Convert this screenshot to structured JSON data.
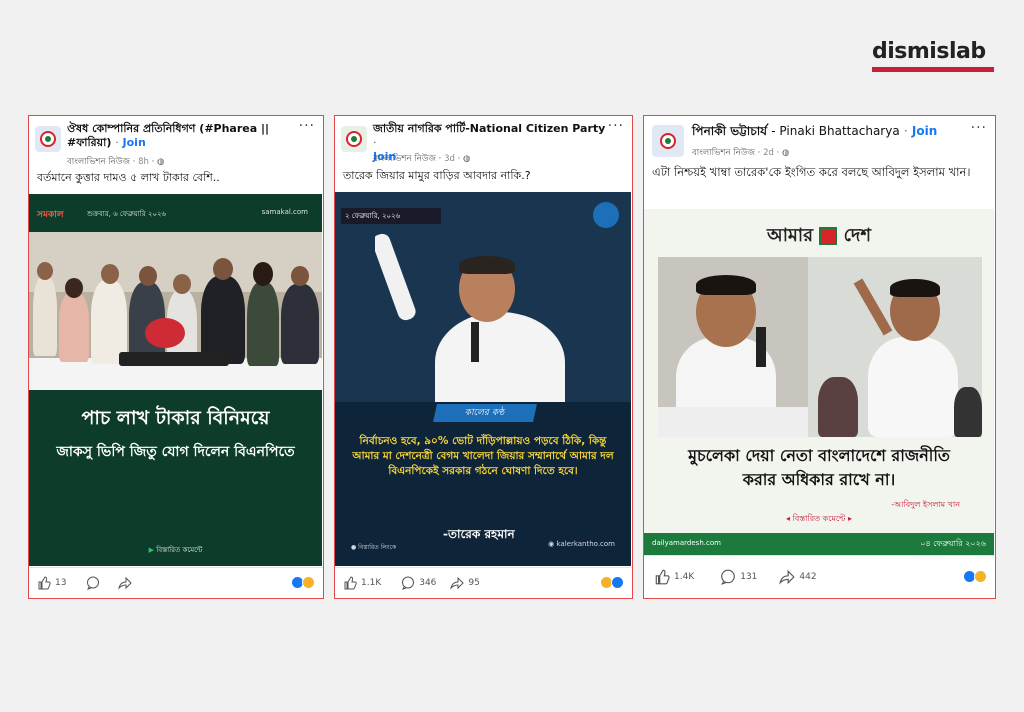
{
  "brand": {
    "logo_text": "dismislab",
    "accent": "#c8203a"
  },
  "posts": [
    {
      "page_name": "ঔষধ কোম্পানির প্রতিনিধিগণ (#Pharea || #ফারিয়া)",
      "join": "Join",
      "source": "বাংলাভিশন নিউজ",
      "time": "8h",
      "caption": "বর্তমানে কুত্তার দামও ৫ লাখ টাকার বেশি..",
      "image": {
        "outlet": "সমকাল",
        "date": "শুক্রবার, ৬ ফেব্রুয়ারি ২০২৬",
        "site": "samakal.com",
        "headline1": "পাচ লাখ টাকার বিনিময়ে",
        "headline2": "জাকসু ভিপি জিতু যোগ দিলেন বিএনপিতে",
        "cta": "বিস্তারিত কমেন্টে"
      },
      "likes": "13",
      "comments": "",
      "shares": ""
    },
    {
      "page_name": "জাতীয় নাগরিক পার্টি-National Citizen Party",
      "join": "Join",
      "source": "বাংলাভিশন নিউজ",
      "time": "3d",
      "caption": "তারেক জিয়ার মামুর বাড়ির আবদার নাকি.?",
      "image": {
        "date": "২ ফেব্রুয়ারি, ২০২৬",
        "outlet": "কালের কণ্ঠ",
        "quote": "নির্বাচনও হবে, ৯০% ভোট দাঁড়িপাল্লায়ও পড়বে ঠিকি, কিন্তু আমার মা দেশনেত্রী বেগম খালেদা জিয়ার সম্মানার্থে আমার দল বিএনপিকেই সরকার গঠনে ঘোষণা দিতে হবে।",
        "speaker": "-তারেক রহমান",
        "cta": "বিস্তারিত লিংকে",
        "site": "kalerkantho.com"
      },
      "likes": "1.1K",
      "comments": "346",
      "shares": "95"
    },
    {
      "page_name": "পিনাকী ভট্টাচার্য",
      "page_name_en": "- Pinaki Bhattacharya",
      "join": "Join",
      "source": "বাংলাভিশন নিউজ",
      "time": "2d",
      "caption": "এটা নিশ্চয়ই খাম্বা তারেক'কে ইংগিত করে বলছে আবিদুল ইসলাম খান।",
      "image": {
        "outlet": "আমার দেশ",
        "outlet_left": "আমার",
        "outlet_right": "দেশ",
        "headline1": "মুচলেকা দেয়া নেতা বাংলাদেশে রাজনীতি",
        "headline2": "করার অধিকার রাখে না।",
        "attribution": "-আবিদুল ইসলাম খান",
        "cta": "বিস্তারিত কমেন্টে",
        "site": "dailyamardesh.com",
        "date": "০৪ ফেব্রুয়ারি ২০২৬"
      },
      "likes": "1.4K",
      "comments": "131",
      "shares": "442"
    }
  ]
}
